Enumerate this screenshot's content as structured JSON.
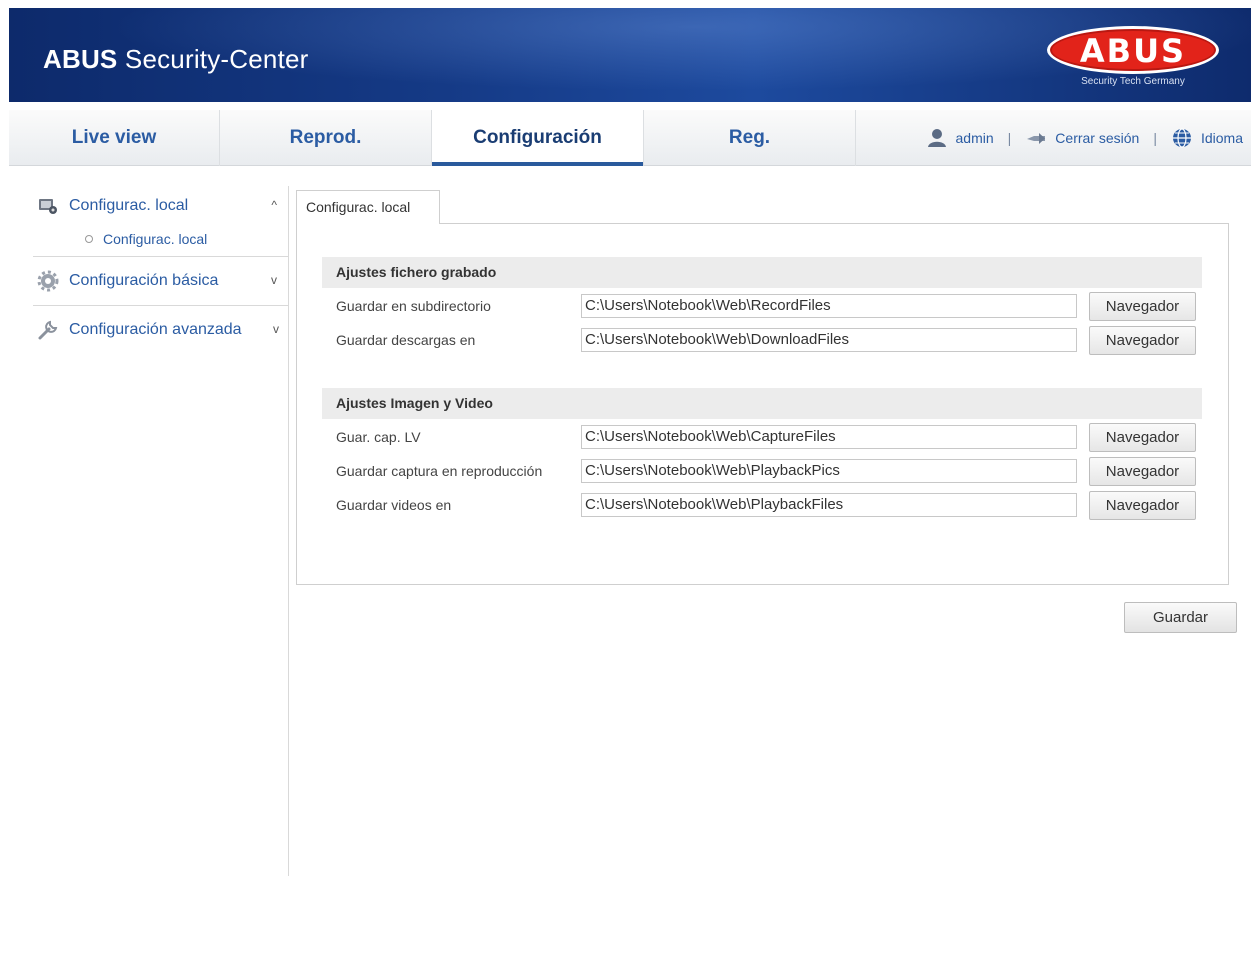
{
  "header": {
    "title_bold": "ABUS",
    "title_rest": " Security-Center",
    "logo_text": "ABUS",
    "logo_tagline": "Security Tech Germany"
  },
  "nav": {
    "tabs": [
      {
        "label": "Live view",
        "active": false
      },
      {
        "label": "Reprod.",
        "active": false
      },
      {
        "label": "Configuración",
        "active": true
      },
      {
        "label": "Reg.",
        "active": false
      }
    ],
    "user": "admin",
    "logout": "Cerrar sesión",
    "language": "Idioma",
    "separator": "|"
  },
  "sidebar": {
    "items": [
      {
        "label": "Configurac. local",
        "icon": "local-config-icon",
        "chevron": "^",
        "expanded": true,
        "children": [
          {
            "label": "Configurac. local"
          }
        ]
      },
      {
        "label": "Configuración básica",
        "icon": "gear-icon",
        "chevron": "v"
      },
      {
        "label": "Configuración avanzada",
        "icon": "wrench-icon",
        "chevron": "v"
      }
    ]
  },
  "content": {
    "tab_label": "Configurac. local",
    "sections": [
      {
        "title": "Ajustes fichero grabado",
        "rows": [
          {
            "label": "Guardar en subdirectorio",
            "value": "C:\\Users\\Notebook\\Web\\RecordFiles",
            "button": "Navegador"
          },
          {
            "label": "Guardar descargas en",
            "value": "C:\\Users\\Notebook\\Web\\DownloadFiles",
            "button": "Navegador"
          }
        ]
      },
      {
        "title": "Ajustes Imagen y Video",
        "rows": [
          {
            "label": "Guar. cap. LV",
            "value": "C:\\Users\\Notebook\\Web\\CaptureFiles",
            "button": "Navegador"
          },
          {
            "label": "Guardar captura en reproducción",
            "value": "C:\\Users\\Notebook\\Web\\PlaybackPics",
            "button": "Navegador"
          },
          {
            "label": "Guardar videos en",
            "value": "C:\\Users\\Notebook\\Web\\PlaybackFiles",
            "button": "Navegador"
          }
        ]
      }
    ],
    "save_label": "Guardar"
  },
  "colors": {
    "banner": "#153a86",
    "link_blue": "#2b5ca3",
    "logo_red": "#e2231a"
  }
}
